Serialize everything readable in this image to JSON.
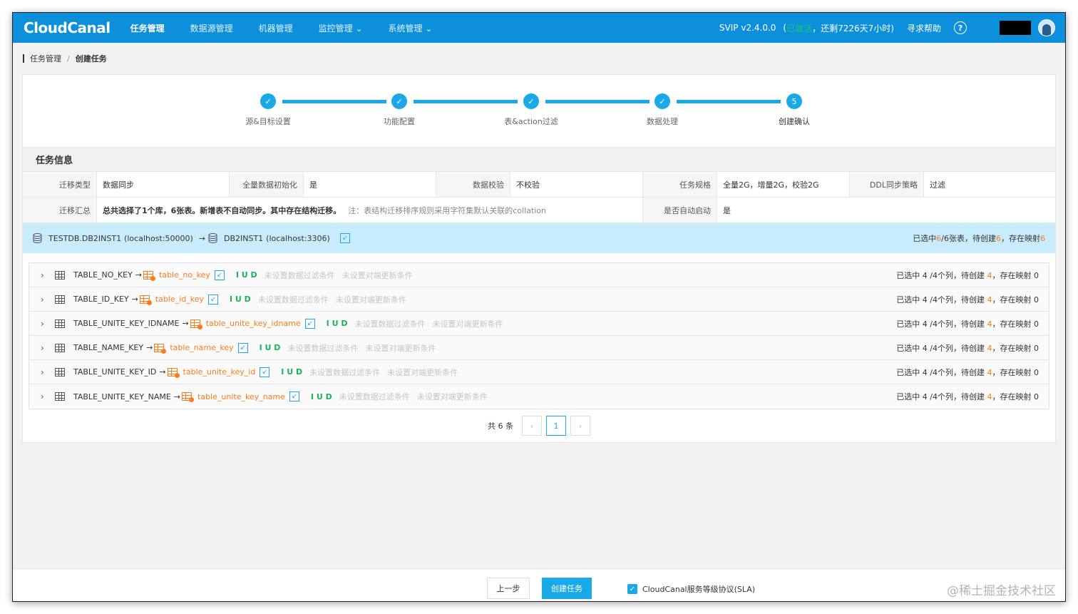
{
  "nav": {
    "logo": "CloudCanal",
    "menu": [
      {
        "label": "任务管理",
        "active": true
      },
      {
        "label": "数据源管理",
        "active": false
      },
      {
        "label": "机器管理",
        "active": false
      },
      {
        "label": "监控管理 ⌄",
        "active": false
      },
      {
        "label": "系统管理 ⌄",
        "active": false
      }
    ],
    "version": "SVIP v2.4.0.0",
    "status_open": "(",
    "status": "已激活",
    "remaining": "，还剩7226天7小时)",
    "help": "寻求帮助",
    "help_icon": "?"
  },
  "breadcrumb": {
    "parent": "任务管理",
    "sep": "/",
    "current": "创建任务"
  },
  "steps": [
    {
      "label": "源&目标设置",
      "mark": "✓"
    },
    {
      "label": "功能配置",
      "mark": "✓"
    },
    {
      "label": "表&action过滤",
      "mark": "✓"
    },
    {
      "label": "数据处理",
      "mark": "✓"
    },
    {
      "label": "创建确认",
      "mark": "5"
    }
  ],
  "task_info": {
    "title": "任务信息",
    "row1": [
      {
        "key": "迁移类型",
        "value": "数据同步"
      },
      {
        "key": "全量数据初始化",
        "value": "是"
      },
      {
        "key": "数据校验",
        "value": "不校验"
      },
      {
        "key": "任务规格",
        "value": "全量2G，增量2G，校验2G"
      },
      {
        "key": "DDL同步策略",
        "value": "过滤"
      }
    ],
    "row2": {
      "key": "迁移汇总",
      "value": "总共选择了1个库，6张表。新增表不自动同步。其中存在结构迁移。",
      "note": "注：表结构迁移排序规则采用字符集默认关联的collation",
      "key2": "是否自动启动",
      "value2": "是"
    }
  },
  "db_bar": {
    "source_db": "TESTDB.DB2INST1",
    "source_host": "(localhost:50000)",
    "arrow": "→",
    "target_db": "DB2INST1",
    "target_host": "(localhost:3306)",
    "summary_prefix": "已选中",
    "selected": "6",
    "summary_mid": "/6张表，待创建",
    "to_create": "6",
    "summary_mid2": "，存在映射",
    "mapped": "6"
  },
  "tables": [
    {
      "source": "TABLE_NO_KEY",
      "target": "table_no_key",
      "ops": "I U D",
      "filter": "未设置数据过滤条件",
      "update": "未设置对端更新条件",
      "cols_prefix": "已选中 4 /4个列，待创建 ",
      "create": "4",
      "map": "，存在映射 0"
    },
    {
      "source": "TABLE_ID_KEY",
      "target": "table_id_key",
      "ops": "I U D",
      "filter": "未设置数据过滤条件",
      "update": "未设置对端更新条件",
      "cols_prefix": "已选中 4 /4个列，待创建 ",
      "create": "4",
      "map": "，存在映射 0"
    },
    {
      "source": "TABLE_UNITE_KEY_IDNAME",
      "target": "table_unite_key_idname",
      "ops": "I U D",
      "filter": "未设置数据过滤条件",
      "update": "未设置对端更新条件",
      "cols_prefix": "已选中 4 /4个列，待创建 ",
      "create": "4",
      "map": "，存在映射 0"
    },
    {
      "source": "TABLE_NAME_KEY",
      "target": "table_name_key",
      "ops": "I U D",
      "filter": "未设置数据过滤条件",
      "update": "未设置对端更新条件",
      "cols_prefix": "已选中 4 /4个列，待创建 ",
      "create": "4",
      "map": "，存在映射 0"
    },
    {
      "source": "TABLE_UNITE_KEY_ID",
      "target": "table_unite_key_id",
      "ops": "I U D",
      "filter": "未设置数据过滤条件",
      "update": "未设置对端更新条件",
      "cols_prefix": "已选中 4 /4个列，待创建 ",
      "create": "4",
      "map": "，存在映射 0"
    },
    {
      "source": "TABLE_UNITE_KEY_NAME",
      "target": "table_unite_key_name",
      "ops": "I U D",
      "filter": "未设置数据过滤条件",
      "update": "未设置对端更新条件",
      "cols_prefix": "已选中 4 /4个列，待创建 ",
      "create": "4",
      "map": "，存在映射 0"
    }
  ],
  "pager": {
    "total": "共 6 条",
    "prev": "‹",
    "page": "1",
    "next": "›"
  },
  "footer": {
    "prev_label": "上一步",
    "create_label": "创建任务",
    "sla_label": "CloudCanal服务等级协议(SLA)",
    "check_mark": "✓",
    "watermark": "@稀土掘金技术社区"
  },
  "colors": {
    "nav_bg": "#0d8fdc",
    "accent": "#1aa9e8",
    "orange": "#ff7a1a",
    "green": "#1ab35a",
    "db_bar_bg": "#c9ecfc"
  }
}
